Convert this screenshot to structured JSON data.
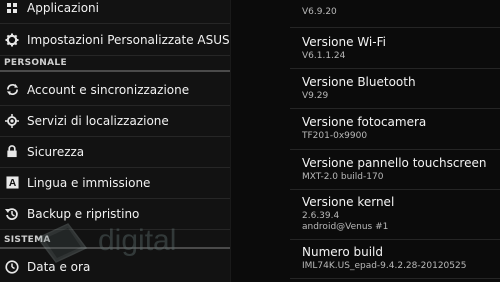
{
  "sidebar": {
    "items_top": [
      {
        "label": "Applicazioni",
        "icon": "apps-icon"
      },
      {
        "label": "Impostazioni Personalizzate ASUS",
        "icon": "gear-icon"
      }
    ],
    "section_personale": "PERSONALE",
    "items_personale": [
      {
        "label": "Account e sincronizzazione",
        "icon": "sync-icon"
      },
      {
        "label": "Servizi di localizzazione",
        "icon": "location-icon"
      },
      {
        "label": "Sicurezza",
        "icon": "lock-icon"
      },
      {
        "label": "Lingua e immissione",
        "icon": "language-icon"
      },
      {
        "label": "Backup e ripristino",
        "icon": "backup-icon"
      }
    ],
    "section_sistema": "SISTEMA",
    "items_sistema": [
      {
        "label": "Data e ora",
        "icon": "clock-icon"
      }
    ]
  },
  "watermark": {
    "text": "digital"
  },
  "info": [
    {
      "title": "",
      "value": "V6.9.20"
    },
    {
      "title": "Versione Wi-Fi",
      "value": "V6.1.1.24"
    },
    {
      "title": "Versione Bluetooth",
      "value": "V9.29"
    },
    {
      "title": "Versione fotocamera",
      "value": "TF201-0x9900"
    },
    {
      "title": "Versione pannello touchscreen",
      "value": "MXT-2.0 build-170"
    },
    {
      "title": "Versione kernel",
      "value": "2.6.39.4",
      "value2": "android@Venus #1"
    },
    {
      "title": "Numero build",
      "value": "IML74K.US_epad-9.4.2.28-20120525"
    }
  ]
}
